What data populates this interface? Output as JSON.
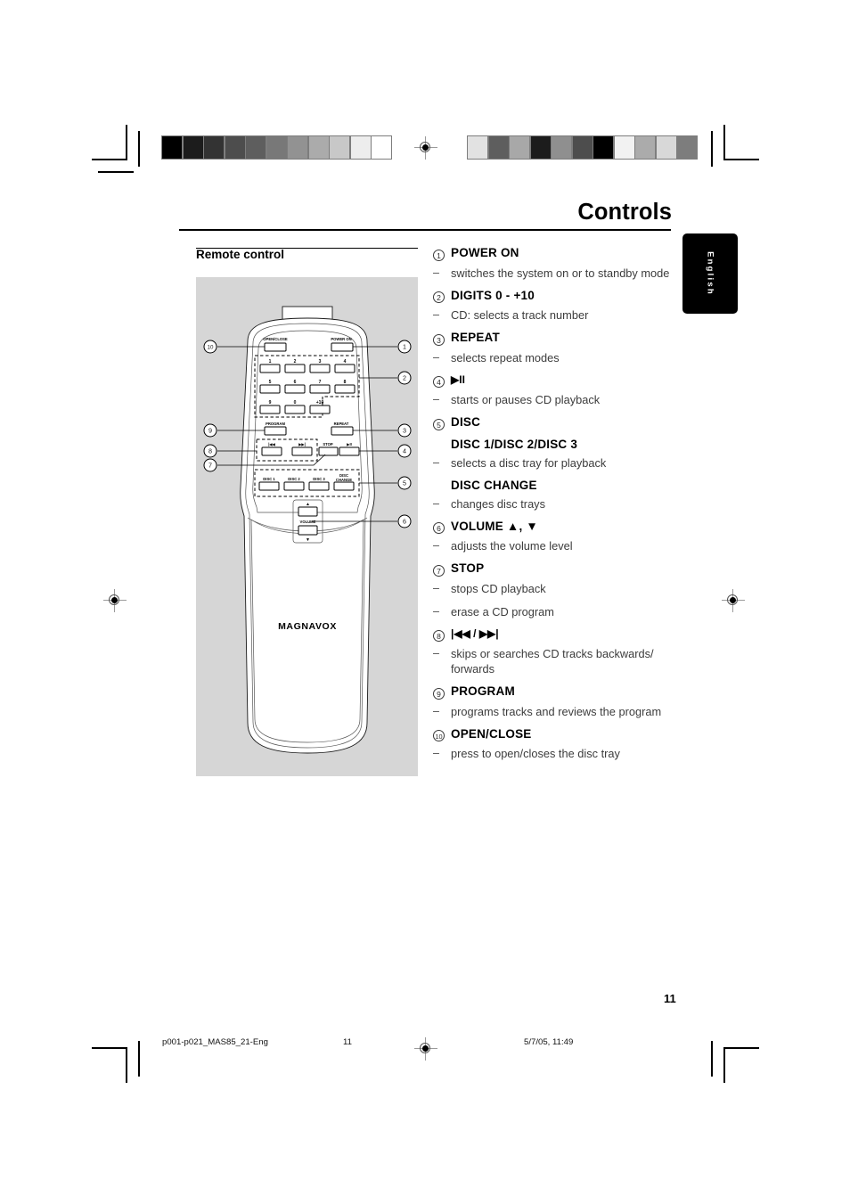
{
  "header": {
    "title": "Controls",
    "language_tab": "English"
  },
  "left": {
    "section_heading": "Remote control",
    "remote": {
      "brand": "MAGNAVOX",
      "buttons": {
        "open_close": "OPEN/CLOSE",
        "power_on": "POWER ON",
        "digits": [
          "1",
          "2",
          "3",
          "4",
          "5",
          "6",
          "7",
          "8",
          "9",
          "0",
          "+10"
        ],
        "program": "PROGRAM",
        "repeat": "REPEAT",
        "prev": "|◀◀",
        "next": "▶▶|",
        "stop": "STOP",
        "play_pause": "▶II",
        "disc1": "DISC 1",
        "disc2": "DISC 2",
        "disc3": "DISC 3",
        "disc_change": "DISC CHANGE",
        "volume": "VOLUME",
        "volume_up": "▲",
        "volume_down": "▼"
      },
      "callouts": [
        "1",
        "2",
        "3",
        "4",
        "5",
        "6",
        "7",
        "8",
        "9",
        "10"
      ]
    }
  },
  "right": {
    "entries": [
      {
        "num": "1",
        "label": "POWER ON",
        "bullets": [
          "switches the system on or to standby mode"
        ]
      },
      {
        "num": "2",
        "label": "DIGITS 0 - +10",
        "bullets": [
          "CD: selects a track number"
        ]
      },
      {
        "num": "3",
        "label": "REPEAT",
        "bullets": [
          " selects repeat modes"
        ]
      },
      {
        "num": "4",
        "label": "▶II",
        "bullets": [
          "starts or pauses CD playback"
        ]
      },
      {
        "num": "5",
        "label": "DISC",
        "sublabel1": "DISC 1/DISC 2/DISC 3",
        "bullet1": "selects a disc tray for playback",
        "sublabel2": "DISC CHANGE",
        "bullet2": "changes disc trays"
      },
      {
        "num": "6",
        "label": "VOLUME ▲, ▼",
        "bullets": [
          "adjusts the volume level"
        ]
      },
      {
        "num": "7",
        "label": "STOP",
        "bullets": [
          "stops CD playback",
          " erase a CD program"
        ]
      },
      {
        "num": "8",
        "label": "|◀◀ / ▶▶|",
        "bullets": [
          "skips or searches CD tracks backwards/ forwards"
        ]
      },
      {
        "num": "9",
        "label": "PROGRAM",
        "bullets": [
          "programs tracks and reviews the program"
        ]
      },
      {
        "num": "10",
        "label": "OPEN/CLOSE",
        "bullets": [
          "press to open/closes the disc tray"
        ]
      }
    ]
  },
  "footer": {
    "page_number": "11",
    "filename": "p001-p021_MAS85_21-Eng",
    "footer_page": "11",
    "timestamp": "5/7/05, 11:49"
  },
  "calibration": {
    "bar_left": [
      "#000000",
      "#1c1c1c",
      "#333333",
      "#4d4d4d",
      "#5e5e5e",
      "#787878",
      "#929292",
      "#ababab",
      "#c8c8c8",
      "#ededed",
      "#ffffff"
    ],
    "bar_right": [
      "#e2e2e2",
      "#5e5e5e",
      "#a8a8a8",
      "#1c1c1c",
      "#8f8f8f",
      "#4d4d4d",
      "#000000",
      "#f2f2f2",
      "#ababab",
      "#d8d8d8",
      "#7d7d7d"
    ]
  }
}
